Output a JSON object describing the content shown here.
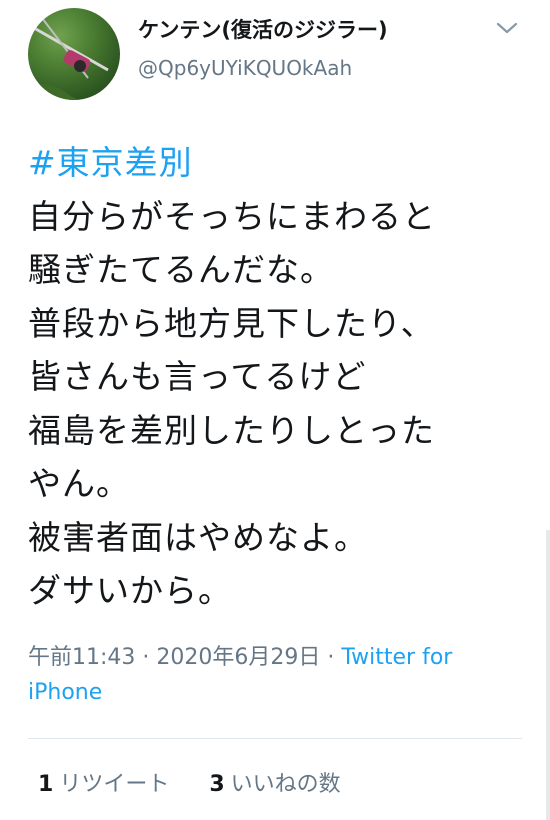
{
  "user": {
    "display_name": "ケンテン(復活のジジラー)",
    "handle": "@Qp6yUYiKQUOkAah"
  },
  "tweet": {
    "hashtag": "#東京差別",
    "lines": [
      "自分らがそっちにまわると",
      "騒ぎたてるんだな。",
      "普段から地方見下したり、",
      "皆さんも言ってるけど",
      "福島を差別したりしとった",
      "やん。",
      "被害者面はやめなよ。",
      "ダサいから。"
    ]
  },
  "meta": {
    "time": "午前11:43",
    "separator": " · ",
    "date": "2020年6月29日",
    "source_prefix": " · ",
    "source": "Twitter for iPhone"
  },
  "stats": {
    "retweets_count": "1",
    "retweets_label": "リツイート",
    "likes_count": "3",
    "likes_label": "いいねの数"
  },
  "icons": {
    "menu": "chevron-down-icon",
    "avatar": "profile-photo"
  },
  "colors": {
    "link": "#1da1f2",
    "text": "#14171a",
    "secondary": "#657786"
  }
}
